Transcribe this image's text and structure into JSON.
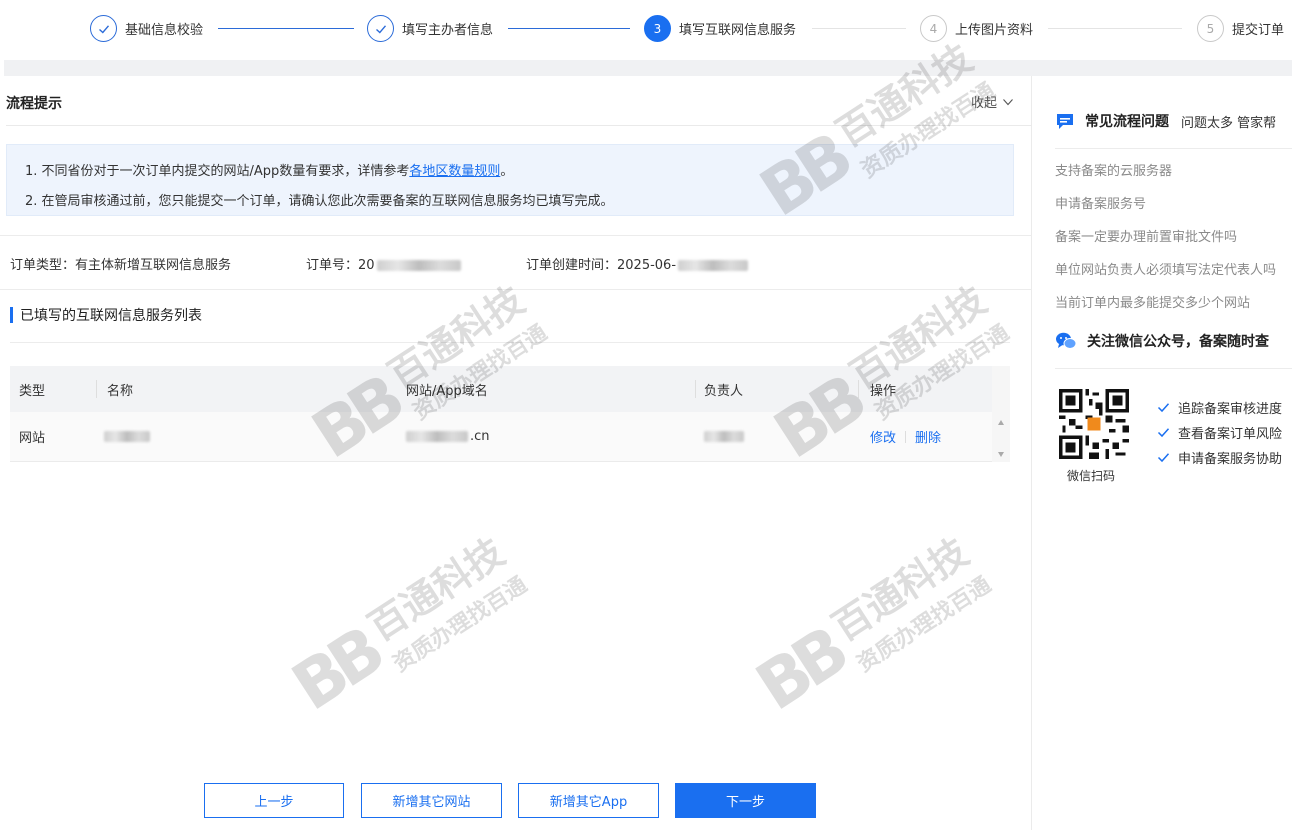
{
  "steps": [
    {
      "label": "基础信息校验",
      "state": "done",
      "num": ""
    },
    {
      "label": "填写主办者信息",
      "state": "done",
      "num": ""
    },
    {
      "label": "填写互联网信息服务",
      "state": "active",
      "num": "3"
    },
    {
      "label": "上传图片资料",
      "state": "todo",
      "num": "4"
    },
    {
      "label": "提交订单",
      "state": "todo",
      "num": "5"
    }
  ],
  "tip": {
    "title": "流程提示",
    "collapse_label": "收起",
    "line1_prefix": "1. 不同省份对于一次订单内提交的网站/App数量有要求，详情参考",
    "line1_link": "各地区数量规则",
    "line1_suffix": "。",
    "line2": "2. 在管局审核通过前，您只能提交一个订单，请确认您此次需要备案的互联网信息服务均已填写完成。"
  },
  "order": {
    "type_label": "订单类型：有主体新增互联网信息服务",
    "number_label": "订单号：20",
    "created_label": "订单创建时间：2025-06-"
  },
  "list": {
    "title": "已填写的互联网信息服务列表",
    "columns": [
      "类型",
      "名称",
      "网站/App域名",
      "负责人",
      "操作"
    ],
    "rows": [
      {
        "type": "网站",
        "name": "",
        "domain_suffix": ".cn",
        "owner": "",
        "edit": "修改",
        "delete": "删除"
      }
    ]
  },
  "buttons": {
    "prev": "上一步",
    "add_site": "新增其它网站",
    "add_app": "新增其它App",
    "next": "下一步"
  },
  "side": {
    "faq_title": "常见流程问题",
    "faq_sub": "问题太多 管家帮",
    "faqs": [
      "支持备案的云服务器",
      "申请备案服务号",
      "备案一定要办理前置审批文件吗",
      "单位网站负责人必须填写法定代表人吗",
      "当前订单内最多能提交多少个网站"
    ],
    "wechat_title": "关注微信公众号，备案随时查",
    "qr_caption": "微信扫码",
    "features": [
      "追踪备案审核进度",
      "查看备案订单风险",
      "申请备案服务协助"
    ]
  },
  "watermark": {
    "logo": "BB",
    "line1": "百通科技",
    "line2": "资质办理找百通"
  },
  "colors": {
    "primary": "#1a6ff0",
    "tip_bg": "#eef4fd"
  }
}
